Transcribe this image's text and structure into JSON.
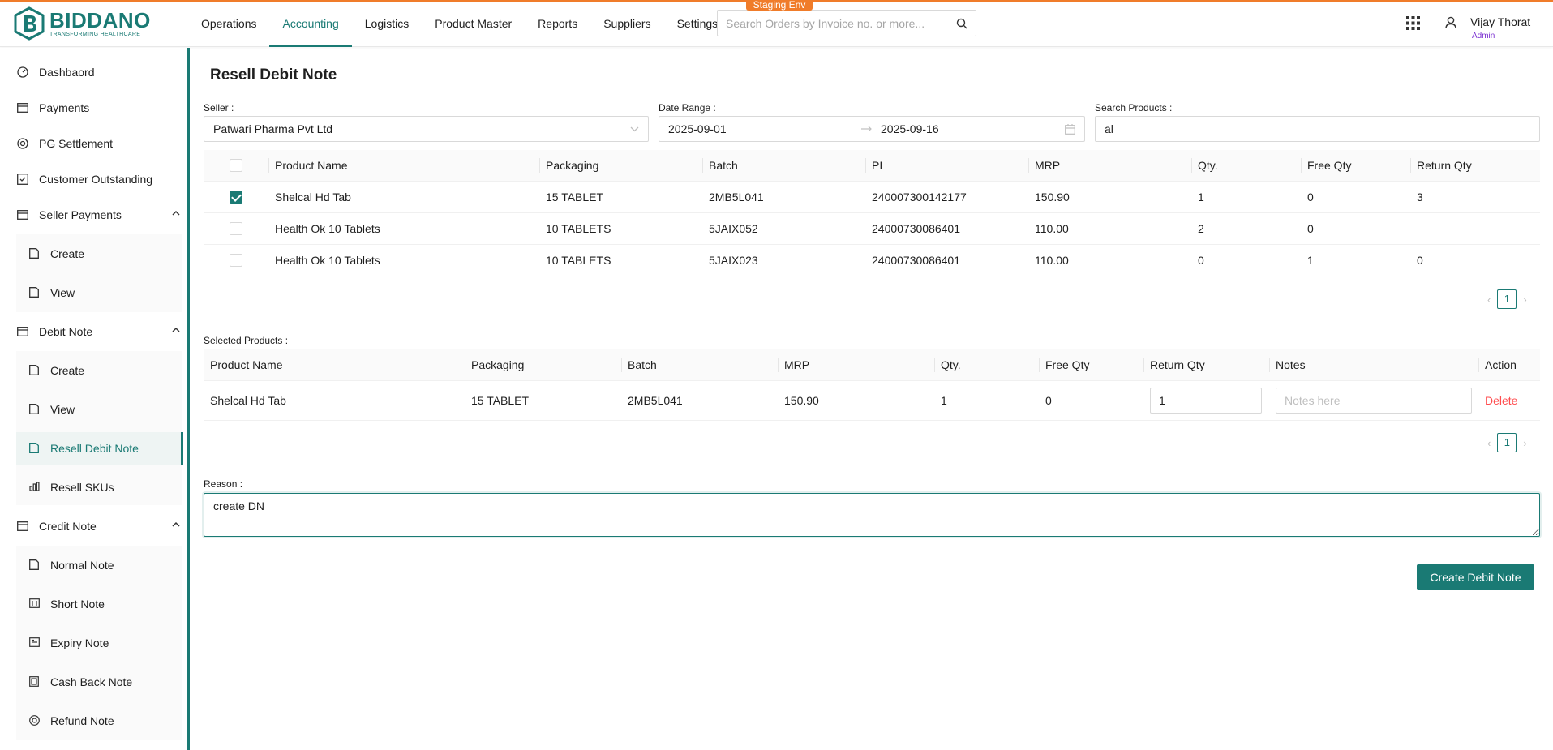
{
  "env_badge": "Staging Env",
  "brand": {
    "name": "BIDDANO",
    "tagline": "TRANSFORMING HEALTHCARE",
    "accent": "#1a7a74",
    "top_bar_color": "#f07c2a"
  },
  "nav": [
    {
      "label": "Operations"
    },
    {
      "label": "Accounting",
      "active": true
    },
    {
      "label": "Logistics"
    },
    {
      "label": "Product Master"
    },
    {
      "label": "Reports"
    },
    {
      "label": "Suppliers"
    },
    {
      "label": "Settings"
    }
  ],
  "search": {
    "placeholder": "Search Orders by Invoice no. or more...",
    "icon": "search-icon"
  },
  "user": {
    "name": "Vijay Thorat",
    "role": "Admin"
  },
  "sidebar": {
    "dashboard": "Dashbaord",
    "payments": "Payments",
    "pg_settlement": "PG Settlement",
    "customer_outstanding": "Customer Outstanding",
    "seller_payments": "Seller Payments",
    "seller_payments_create": "Create",
    "seller_payments_view": "View",
    "debit_note": "Debit Note",
    "debit_note_create": "Create",
    "debit_note_view": "View",
    "resell_debit_note": "Resell Debit Note",
    "resell_skus": "Resell SKUs",
    "credit_note": "Credit Note",
    "normal_note": "Normal Note",
    "short_note": "Short Note",
    "expiry_note": "Expiry Note",
    "cash_back_note": "Cash Back Note",
    "refund_note": "Refund Note"
  },
  "page": {
    "title": "Resell Debit Note"
  },
  "filters": {
    "seller_label": "Seller :",
    "seller_value": "Patwari Pharma Pvt Ltd",
    "date_label": "Date Range :",
    "date_from": "2025-09-01",
    "date_to": "2025-09-16",
    "search_label": "Search Products :",
    "search_value": "al"
  },
  "products_table": {
    "headers": [
      "Product Name",
      "Packaging",
      "Batch",
      "PI",
      "MRP",
      "Qty.",
      "Free Qty",
      "Return Qty"
    ],
    "rows": [
      {
        "checked": true,
        "cells": [
          "Shelcal Hd Tab",
          "15 TABLET",
          "2MB5L041",
          "240007300142177",
          "150.90",
          "1",
          "0",
          "3"
        ]
      },
      {
        "checked": false,
        "cells": [
          "Health Ok 10 Tablets",
          "10 TABLETS",
          "5JAIX052",
          "24000730086401",
          "110.00",
          "2",
          "0",
          ""
        ]
      },
      {
        "checked": false,
        "cells": [
          "Health Ok 10 Tablets",
          "10 TABLETS",
          "5JAIX023",
          "24000730086401",
          "110.00",
          "0",
          "1",
          "0"
        ]
      }
    ],
    "page": "1"
  },
  "selected": {
    "label": "Selected Products :",
    "headers": [
      "Product Name",
      "Packaging",
      "Batch",
      "MRP",
      "Qty.",
      "Free Qty",
      "Return Qty",
      "Notes",
      "Action"
    ],
    "rows": [
      {
        "cells": [
          "Shelcal Hd Tab",
          "15 TABLET",
          "2MB5L041",
          "150.90",
          "1",
          "0"
        ],
        "return_qty": "1",
        "notes_placeholder": "Notes here",
        "action": "Delete"
      }
    ],
    "page": "1"
  },
  "reason": {
    "label": "Reason :",
    "value": "create DN"
  },
  "create_button": "Create Debit Note"
}
